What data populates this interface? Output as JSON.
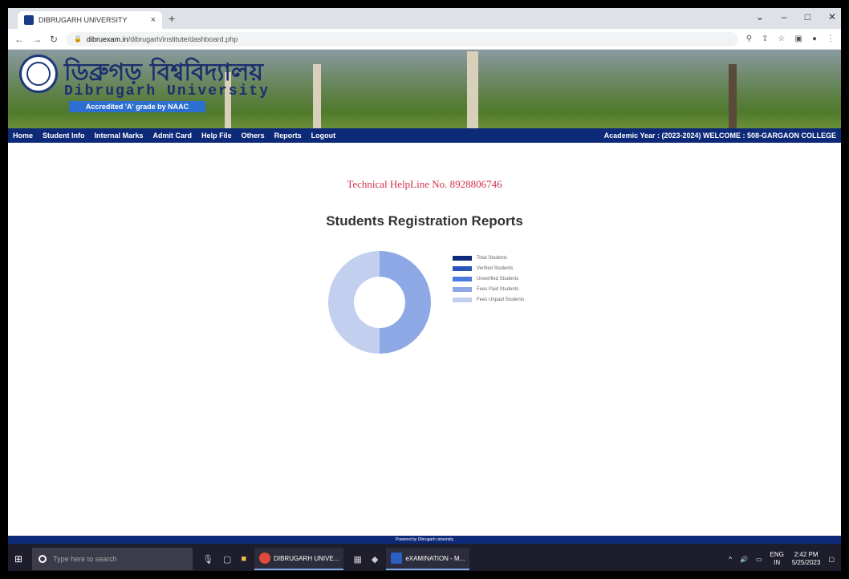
{
  "browser": {
    "tab_title": "DIBRUGARH UNIVERSITY",
    "tab_close": "×",
    "new_tab": "+",
    "url_host": "dibruexam.in",
    "url_path": "/dibrugarh/institute/dashboard.php"
  },
  "banner": {
    "name_bengali": "ডিব্ৰুগড় বিশ্ববিদ্যালয়",
    "name_english": "Dibrugarh University",
    "accreditation": "Accredited 'A' grade by NAAC"
  },
  "menu": {
    "items": [
      "Home",
      "Student Info",
      "Internal Marks",
      "Admit Card",
      "Help File",
      "Others",
      "Reports",
      "Logout"
    ],
    "welcome": "Academic Year : (2023-2024) WELCOME : 508-GARGAON COLLEGE"
  },
  "content": {
    "helpline": "Technical HelpLine No. 8928806746",
    "report_title": "Students Registration Reports"
  },
  "chart_data": {
    "type": "pie",
    "categories": [
      "Total Students",
      "Verified Students",
      "Unverified Students",
      "Fees Paid Students",
      "Fees Unpaid Students"
    ],
    "values": [
      0,
      0,
      0,
      50,
      50
    ],
    "colors": [
      "#0d2a78",
      "#2a55b8",
      "#4a7ae0",
      "#8ea8e6",
      "#c2cfee"
    ],
    "legend_position": "right"
  },
  "footer": {
    "text": "Powered by Dibrugarh university"
  },
  "taskbar": {
    "search_placeholder": "Type here to search",
    "app1": "DIBRUGARH UNIVE...",
    "app2": "eXAMINATION - M...",
    "lang": "ENG",
    "region": "IN",
    "time": "2:42 PM",
    "date": "5/25/2023"
  }
}
